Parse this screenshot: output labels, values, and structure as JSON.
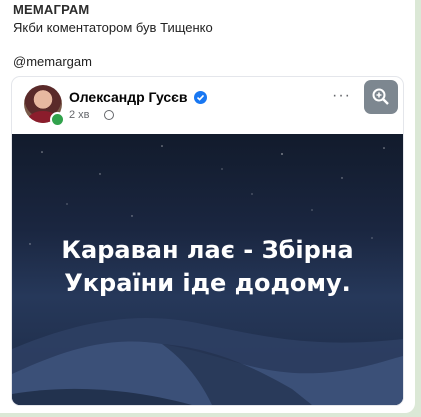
{
  "channel": {
    "name": "МЕМАГРАМ"
  },
  "message": {
    "caption": "Якби коментатором був Тищенко",
    "handle": "@memargam"
  },
  "post": {
    "author": "Олександр Гусєв",
    "time": "2 хв",
    "more_label": "···",
    "image_text_line1": "Караван лає - Збірна",
    "image_text_line2": "України іде додому.",
    "icons": {
      "verified": "verified-badge-icon",
      "privacy": "globe-icon",
      "zoom": "zoom-icon"
    }
  },
  "colors": {
    "chat_background": "#dbe8d6",
    "verified_blue": "#1877f2",
    "online_green": "#31a24c",
    "image_sky": "#1a2640"
  }
}
